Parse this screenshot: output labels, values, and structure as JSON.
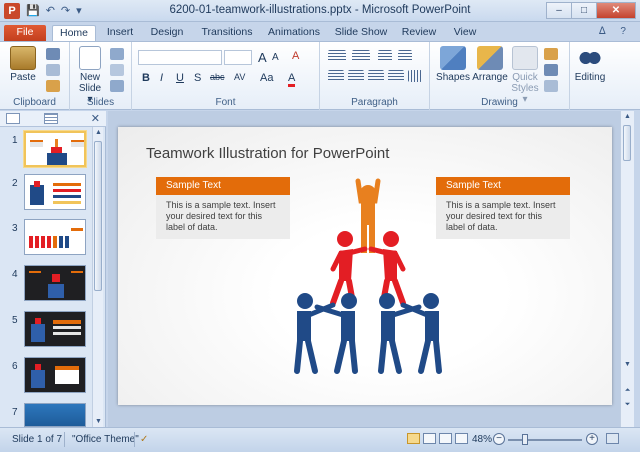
{
  "window": {
    "title": "6200-01-teamwork-illustrations.pptx - Microsoft PowerPoint",
    "app_icon_letter": "P",
    "controls": [
      "–",
      "□",
      "✕"
    ]
  },
  "quick_access": [
    "💾",
    "↶",
    "↷",
    "▾"
  ],
  "tabs": [
    {
      "label": "File"
    },
    {
      "label": "Home"
    },
    {
      "label": "Insert"
    },
    {
      "label": "Design"
    },
    {
      "label": "Transitions"
    },
    {
      "label": "Animations"
    },
    {
      "label": "Slide Show"
    },
    {
      "label": "Review"
    },
    {
      "label": "View"
    }
  ],
  "tabs_right_icons": "ᐃ ?",
  "ribbon": {
    "clipboard": {
      "label": "Clipboard",
      "paste": "Paste"
    },
    "slides": {
      "label": "Slides",
      "new_slide": "New",
      "new_slide2": "Slide ▾"
    },
    "font": {
      "label": "Font",
      "buttons": [
        "B",
        "I",
        "U",
        "S",
        "abc",
        "AV",
        "Aa",
        "A"
      ],
      "grow": "A",
      "shrink": "A",
      "clear": "A"
    },
    "paragraph": {
      "label": "Paragraph"
    },
    "drawing": {
      "label": "Drawing",
      "shapes": "Shapes",
      "arrange": "Arrange",
      "quick_styles": "Quick",
      "quick_styles2": "Styles ▾"
    },
    "editing": {
      "label": "Editing"
    }
  },
  "thumbnails": [
    {
      "num": "1"
    },
    {
      "num": "2"
    },
    {
      "num": "3"
    },
    {
      "num": "4"
    },
    {
      "num": "5"
    },
    {
      "num": "6"
    },
    {
      "num": "7"
    }
  ],
  "slide": {
    "title": "Teamwork Illustration for PowerPoint",
    "left_box": {
      "header": "Sample Text",
      "body": "This is a sample text. Insert your desired text for this label of data."
    },
    "right_box": {
      "header": "Sample Text",
      "body": "This is a sample text. Insert your desired text for this label of data."
    }
  },
  "status": {
    "slide_counter": "Slide 1 of 7",
    "theme": "\"Office Theme\"",
    "zoom": "48%",
    "zoom_minus": "−",
    "zoom_plus": "+"
  },
  "colors": {
    "accent_orange": "#e36c0a",
    "figure_orange": "#e8801f",
    "figure_red": "#e31e24",
    "figure_blue": "#204a87"
  }
}
